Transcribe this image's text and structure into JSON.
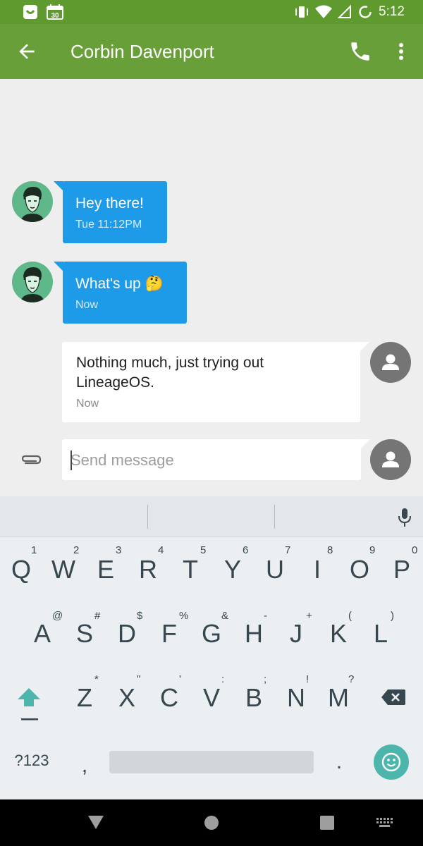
{
  "status_bar": {
    "time": "5:12",
    "icons": [
      "messaging-notification-icon",
      "calendar-icon",
      "vibrate-icon",
      "wifi-icon",
      "signal-icon",
      "battery-icon"
    ],
    "calendar_day": "30"
  },
  "app_bar": {
    "title": "Corbin Davenport",
    "color": "#689f38",
    "status_color": "#5f9a2f"
  },
  "messages": [
    {
      "direction": "incoming",
      "text": "Hey there!",
      "time": "Tue 11:12PM"
    },
    {
      "direction": "incoming",
      "text": "What's up 🤔",
      "time": "Now"
    },
    {
      "direction": "outgoing",
      "text_lines": [
        "Nothing much, just trying out",
        "LineageOS."
      ],
      "time": "Now"
    }
  ],
  "composer": {
    "placeholder": "Send message",
    "value": ""
  },
  "keyboard": {
    "row1": [
      {
        "key": "Q",
        "hint": "1"
      },
      {
        "key": "W",
        "hint": "2"
      },
      {
        "key": "E",
        "hint": "3"
      },
      {
        "key": "R",
        "hint": "4"
      },
      {
        "key": "T",
        "hint": "5"
      },
      {
        "key": "Y",
        "hint": "6"
      },
      {
        "key": "U",
        "hint": "7"
      },
      {
        "key": "I",
        "hint": "8"
      },
      {
        "key": "O",
        "hint": "9"
      },
      {
        "key": "P",
        "hint": "0"
      }
    ],
    "row2": [
      {
        "key": "A",
        "hint": "@"
      },
      {
        "key": "S",
        "hint": "#"
      },
      {
        "key": "D",
        "hint": "$"
      },
      {
        "key": "F",
        "hint": "%"
      },
      {
        "key": "G",
        "hint": "&"
      },
      {
        "key": "H",
        "hint": "-"
      },
      {
        "key": "J",
        "hint": "+"
      },
      {
        "key": "K",
        "hint": "("
      },
      {
        "key": "L",
        "hint": ")"
      }
    ],
    "row3": [
      {
        "key": "Z",
        "hint": "*"
      },
      {
        "key": "X",
        "hint": "\""
      },
      {
        "key": "C",
        "hint": "'"
      },
      {
        "key": "V",
        "hint": ":"
      },
      {
        "key": "B",
        "hint": ";"
      },
      {
        "key": "N",
        "hint": "!"
      },
      {
        "key": "M",
        "hint": "?"
      }
    ],
    "symbols_label": "?123",
    "comma": ",",
    "period": ".",
    "accent_color": "#4db6ac"
  }
}
